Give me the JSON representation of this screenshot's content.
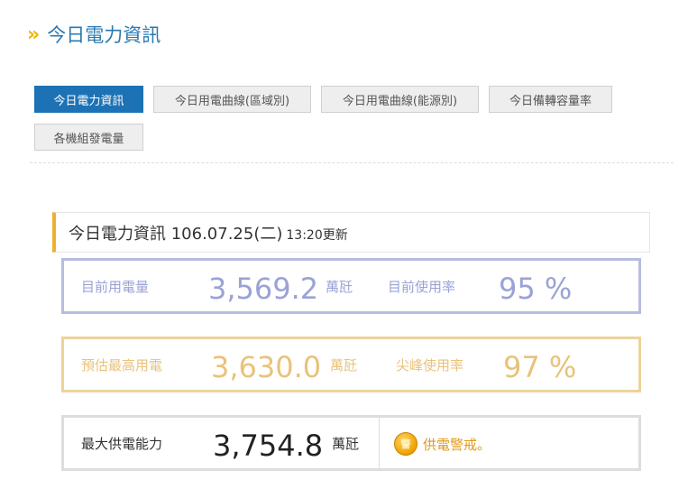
{
  "header": {
    "title": "今日電力資訊",
    "chevron_glyph": "»"
  },
  "tabs": [
    {
      "label": "今日電力資訊",
      "active": true
    },
    {
      "label": "今日用電曲線(區域別)",
      "active": false
    },
    {
      "label": "今日用電曲線(能源別)",
      "active": false
    },
    {
      "label": "今日備轉容量率",
      "active": false
    },
    {
      "label": "各機組發電量",
      "active": false
    }
  ],
  "info": {
    "title": "今日電力資訊 106.07.25(二)",
    "updated": "13:20更新"
  },
  "current": {
    "label": "目前用電量",
    "value": "3,569.2",
    "unit": "萬瓩",
    "rate_label": "目前使用率",
    "rate_value": "95 %"
  },
  "forecast": {
    "label": "預估最高用電",
    "value": "3,630.0",
    "unit": "萬瓩",
    "rate_label": "尖峰使用率",
    "rate_value": "97 %"
  },
  "capacity": {
    "label": "最大供電能力",
    "value": "3,754.8",
    "unit": "萬瓩",
    "status_icon_text": "警",
    "status_text": "供電警戒。"
  },
  "colors": {
    "accent_blue": "#1c72b5",
    "current_color": "#9aa2d6",
    "forecast_color": "#e9c27a",
    "warning_orange": "#e09a1c",
    "chevron_yellow": "#f0b400"
  }
}
